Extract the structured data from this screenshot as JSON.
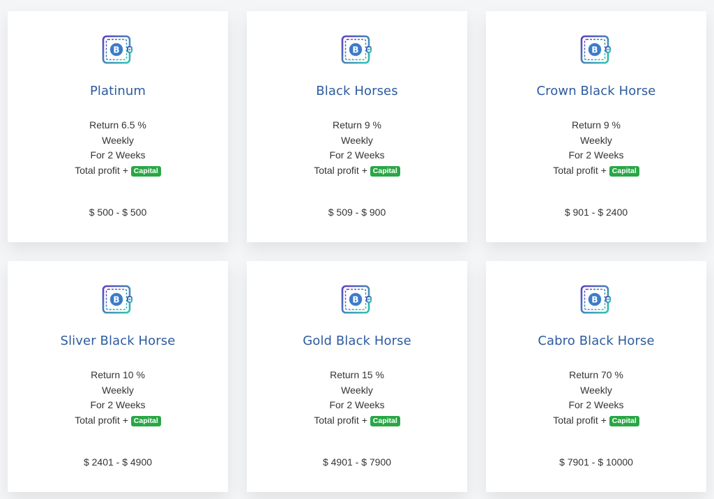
{
  "colors": {
    "plan_name": "#2c5b9e",
    "capital_badge": "#28a745",
    "text": "#333333",
    "card_background": "#ffffff",
    "page_background": "#f4f5f7"
  },
  "icon": "bitcoin-wallet-icon",
  "plans": [
    {
      "name": "Platinum",
      "return_text": "Return 6.5 %",
      "frequency": "Weekly",
      "duration": "For 2 Weeks",
      "profit_text": "Total profit +",
      "badge": "Capital",
      "range": "$ 500 - $ 500"
    },
    {
      "name": "Black Horses",
      "return_text": "Return 9 %",
      "frequency": "Weekly",
      "duration": "For 2 Weeks",
      "profit_text": "Total profit +",
      "badge": "Capital",
      "range": "$ 509 - $ 900"
    },
    {
      "name": "Crown Black Horse",
      "return_text": "Return 9 %",
      "frequency": "Weekly",
      "duration": "For 2 Weeks",
      "profit_text": "Total profit +",
      "badge": "Capital",
      "range": "$ 901 - $ 2400"
    },
    {
      "name": "Sliver Black Horse",
      "return_text": "Return 10 %",
      "frequency": "Weekly",
      "duration": "For 2 Weeks",
      "profit_text": "Total profit +",
      "badge": "Capital",
      "range": "$ 2401 - $ 4900"
    },
    {
      "name": "Gold Black Horse",
      "return_text": "Return 15 %",
      "frequency": "Weekly",
      "duration": "For 2 Weeks",
      "profit_text": "Total profit +",
      "badge": "Capital",
      "range": "$ 4901 - $ 7900"
    },
    {
      "name": "Cabro Black Horse",
      "return_text": "Return 70 %",
      "frequency": "Weekly",
      "duration": "For 2 Weeks",
      "profit_text": "Total profit +",
      "badge": "Capital",
      "range": "$ 7901 - $ 10000"
    }
  ]
}
